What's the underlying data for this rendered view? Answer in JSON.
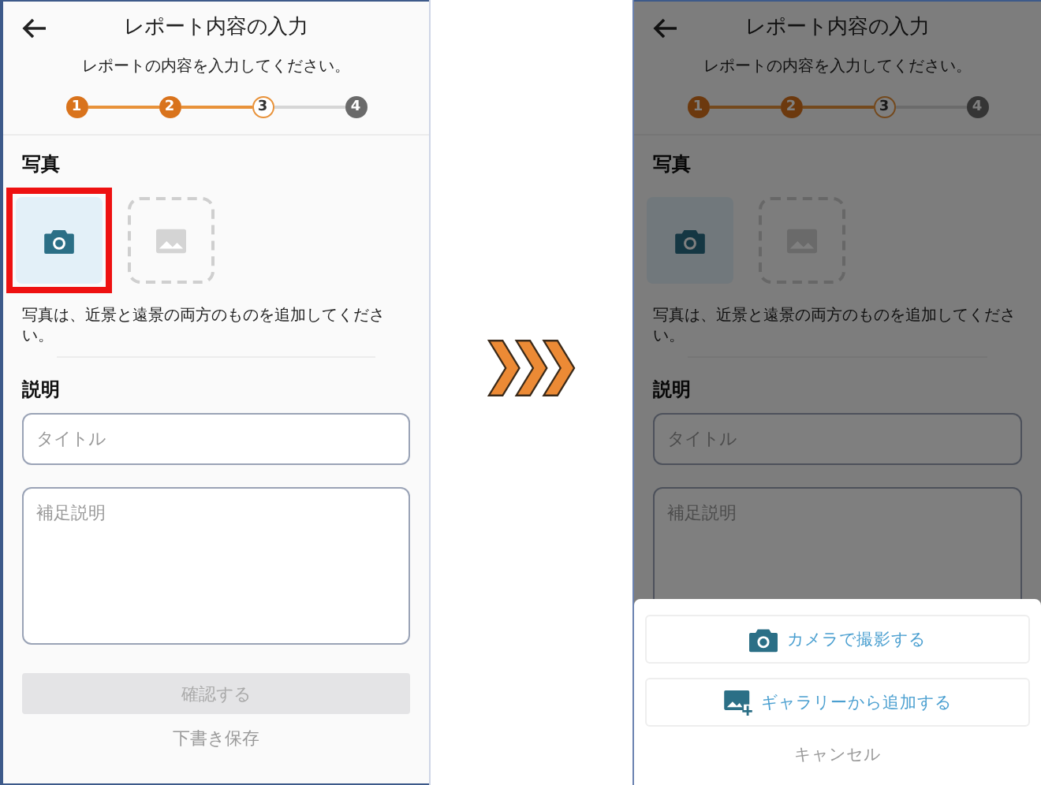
{
  "screens": [
    {
      "dimmed": false,
      "title": "レポート内容の入力",
      "subtitle": "レポートの内容を入力してください。",
      "steps": [
        {
          "label": "1",
          "done": true,
          "current": false
        },
        {
          "label": "2",
          "done": true,
          "current": false
        },
        {
          "label": "3",
          "done": false,
          "current": true
        },
        {
          "label": "4",
          "done": false,
          "current": false
        }
      ],
      "photo_heading": "写真",
      "slots": [
        {
          "kind": "camera",
          "highlighted": true
        },
        {
          "kind": "gallery",
          "highlighted": false
        }
      ],
      "photo_note": "写真は、近景と遠景の両方のものを追加してください。",
      "description_heading": "説明",
      "title_placeholder": "タイトル",
      "detail_placeholder": "補足説明",
      "confirm_button": {
        "label": "確認する",
        "disabled": true
      },
      "draft_link": "下書き保存"
    },
    {
      "dimmed": true,
      "title": "レポート内容の入力",
      "subtitle": "レポートの内容を入力してください。",
      "steps": [
        {
          "label": "1",
          "done": true,
          "current": false
        },
        {
          "label": "2",
          "done": true,
          "current": false
        },
        {
          "label": "3",
          "done": false,
          "current": true
        },
        {
          "label": "4",
          "done": false,
          "current": false
        }
      ],
      "photo_heading": "写真",
      "slots": [
        {
          "kind": "camera",
          "highlighted": false
        },
        {
          "kind": "gallery",
          "highlighted": false
        }
      ],
      "photo_note": "写真は、近景と遠景の両方のものを追加してください。",
      "description_heading": "説明",
      "title_placeholder": "タイトル",
      "detail_placeholder": "補足説明",
      "sheet": {
        "options": [
          {
            "kind": "camera",
            "label": "カメラで撮影する"
          },
          {
            "kind": "gallery",
            "label": "ギャラリーから追加する"
          }
        ],
        "cancel": "キャンセル"
      }
    }
  ]
}
